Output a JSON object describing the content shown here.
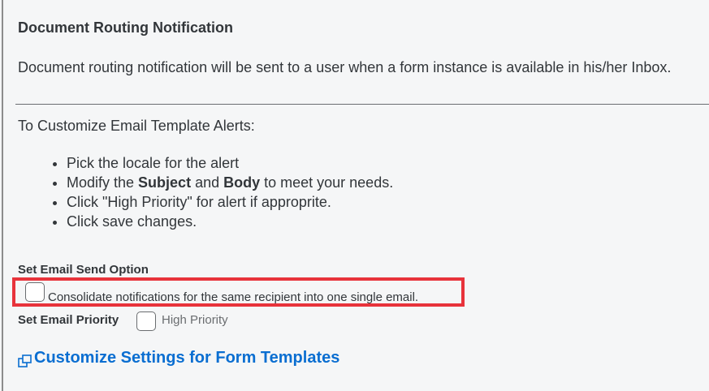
{
  "section": {
    "title": "Document Routing Notification",
    "description": "Document routing notification will be sent to a user when a form instance is available in his/her Inbox."
  },
  "instructions": {
    "heading": "To Customize Email Template Alerts:",
    "step1": "Pick the locale for the alert",
    "step2_prefix": "Modify the ",
    "step2_subject": "Subject",
    "step2_and": " and ",
    "step2_body": "Body",
    "step2_suffix": " to meet your needs.",
    "step3": "Click \"High Priority\" for alert if approprite.",
    "step4": "Click save changes."
  },
  "send_option": {
    "label": "Set Email Send Option",
    "consolidate_label": "Consolidate notifications for the same recipient into one single email.",
    "consolidate_checked": false,
    "highlight_color": "#e8333b"
  },
  "priority": {
    "label": "Set Email Priority",
    "option_label": "High Priority",
    "checked": false
  },
  "customize_link": {
    "label": "Customize Settings for Form Templates",
    "icon": "external-window-icon",
    "color": "#0a6ed1"
  }
}
